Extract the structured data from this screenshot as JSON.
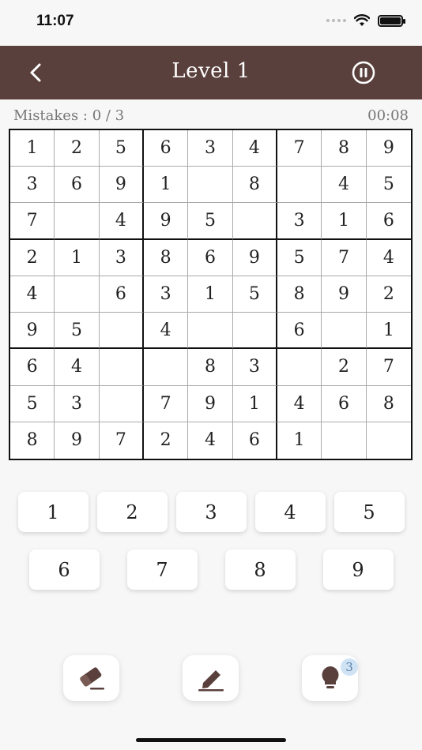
{
  "status_bar": {
    "time": "11:07"
  },
  "nav": {
    "title": "Level 1"
  },
  "info": {
    "mistakes": "Mistakes : 0 / 3",
    "timer": "00:08"
  },
  "board": {
    "rows": [
      [
        "1",
        "2",
        "5",
        "6",
        "3",
        "4",
        "7",
        "8",
        "9"
      ],
      [
        "3",
        "6",
        "9",
        "1",
        "",
        "8",
        "",
        "4",
        "5"
      ],
      [
        "7",
        "",
        "4",
        "9",
        "5",
        "",
        "3",
        "1",
        "6"
      ],
      [
        "2",
        "1",
        "3",
        "8",
        "6",
        "9",
        "5",
        "7",
        "4"
      ],
      [
        "4",
        "",
        "6",
        "3",
        "1",
        "5",
        "8",
        "9",
        "2"
      ],
      [
        "9",
        "5",
        "",
        "4",
        "",
        "",
        "6",
        "",
        "1"
      ],
      [
        "6",
        "4",
        "",
        "",
        "8",
        "3",
        "",
        "2",
        "7"
      ],
      [
        "5",
        "3",
        "",
        "7",
        "9",
        "1",
        "4",
        "6",
        "8"
      ],
      [
        "8",
        "9",
        "7",
        "2",
        "4",
        "6",
        "1",
        "",
        ""
      ]
    ]
  },
  "keypad": {
    "row1": [
      "1",
      "2",
      "3",
      "4",
      "5"
    ],
    "row2": [
      "6",
      "7",
      "8",
      "9"
    ]
  },
  "tools": {
    "hint_count": "3"
  },
  "colors": {
    "nav_bg": "#5a403c",
    "icon": "#5a403c",
    "badge_bg": "#cfe3f5"
  }
}
